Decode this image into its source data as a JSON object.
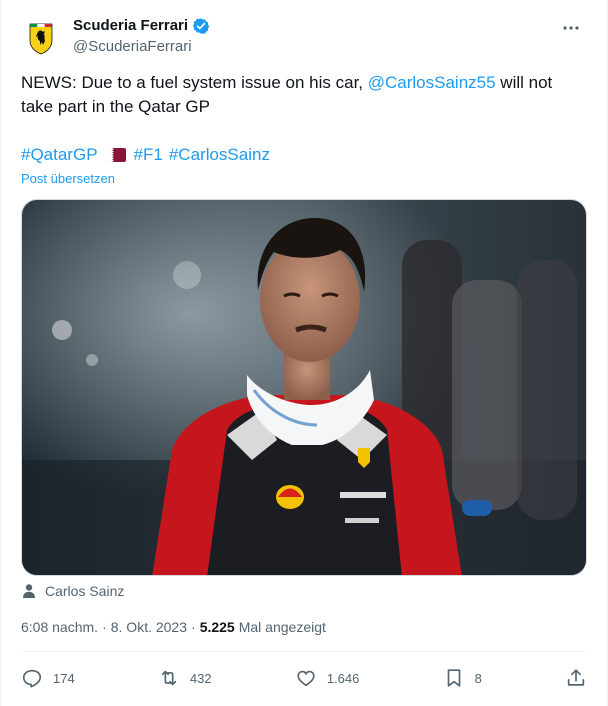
{
  "author": {
    "display_name": "Scuderia Ferrari",
    "handle": "@ScuderiaFerrari"
  },
  "tweet": {
    "text_before": "NEWS: Due to a fuel system issue on his car, ",
    "mention": "@CarlosSainz55",
    "text_after": " will not take part in the Qatar GP",
    "hashtag_1": "#QatarGP",
    "hashtag_2": "#F1",
    "hashtag_3": "#CarlosSainz",
    "translate_label": "Post übersetzen",
    "photo_tag": "Carlos Sainz"
  },
  "meta": {
    "time": "6:08 nachm.",
    "separator_1": "·",
    "date": "8. Okt. 2023",
    "separator_2": "·",
    "views_count": "5.225",
    "views_label": "Mal angezeigt"
  },
  "actions": {
    "replies": "174",
    "reposts": "432",
    "likes": "1.646",
    "bookmarks": "8"
  },
  "colors": {
    "accent": "#1d9bf0",
    "muted": "#536471",
    "verified": "#1d9bf0",
    "ferrari_yellow": "#f7d117",
    "qatar_maroon": "#8a1538"
  }
}
